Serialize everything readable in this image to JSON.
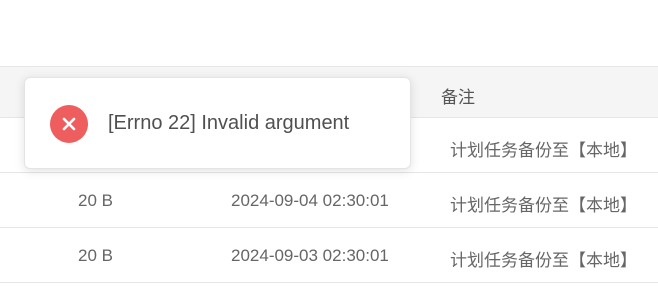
{
  "table": {
    "headers": {
      "note": "备注"
    },
    "rows": [
      {
        "size": "",
        "time": "",
        "note": "计划任务备份至【本地】"
      },
      {
        "size": "20 B",
        "time": "2024-09-04 02:30:01",
        "note": "计划任务备份至【本地】"
      },
      {
        "size": "20 B",
        "time": "2024-09-03 02:30:01",
        "note": "计划任务备份至【本地】"
      }
    ]
  },
  "toast": {
    "icon": "error-close-icon",
    "message": "[Errno 22] Invalid argument",
    "color": "#ef5e5e"
  }
}
